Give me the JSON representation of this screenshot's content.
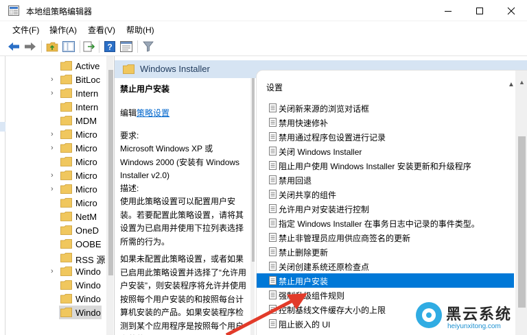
{
  "window": {
    "title": "本地组策略编辑器"
  },
  "menu": [
    "文件(F)",
    "操作(A)",
    "查看(V)",
    "帮助(H)"
  ],
  "tree": {
    "items": [
      {
        "label": "Active",
        "expandable": false
      },
      {
        "label": "BitLoc",
        "expandable": true
      },
      {
        "label": "Intern",
        "expandable": true
      },
      {
        "label": "Intern",
        "expandable": false
      },
      {
        "label": "MDM",
        "expandable": false
      },
      {
        "label": "Micro",
        "expandable": true
      },
      {
        "label": "Micro",
        "expandable": true
      },
      {
        "label": "Micro",
        "expandable": false
      },
      {
        "label": "Micro",
        "expandable": true
      },
      {
        "label": "Micro",
        "expandable": true
      },
      {
        "label": "Micro",
        "expandable": false
      },
      {
        "label": "NetM",
        "expandable": false
      },
      {
        "label": "OneD",
        "expandable": false
      },
      {
        "label": "OOBE",
        "expandable": false
      },
      {
        "label": "RSS 源",
        "expandable": false
      },
      {
        "label": "Windo",
        "expandable": true
      },
      {
        "label": "Windo",
        "expandable": false
      },
      {
        "label": "Windo",
        "expandable": false
      },
      {
        "label": "Windo",
        "expandable": false,
        "selected": true
      }
    ]
  },
  "panel": {
    "header": "Windows Installer",
    "description": {
      "title": "禁止用户安装",
      "edit_prefix": "编辑",
      "edit_link": "策略设置",
      "requirements_label": "要求:",
      "requirements": "Microsoft Windows XP 或 Windows 2000 (安装有 Windows Installer v2.0)",
      "desc_label": "描述:",
      "desc_text": "使用此策略设置可以配置用户安装。若要配置此策略设置，请将其设置为已启用并使用下拉列表选择所需的行为。",
      "desc_text2": "如果未配置此策略设置，或者如果已启用此策略设置并选择了“允许用户安装”，则安装程序将允许并使用按照每个用户安装的和按照每台计算机安装的产品。如果安装程序检测到某个应用程序是按照每个用户安装的，"
    },
    "list": {
      "column_header": "设置",
      "rows": [
        "关闭新来源的浏览对话框",
        "禁用快速修补",
        "禁用通过程序包设置进行记录",
        "关闭 Windows Installer",
        "阻止用户使用 Windows Installer 安装更新和升级程序",
        "禁用回退",
        "关闭共享的组件",
        "允许用户对安装进行控制",
        "指定 Windows Installer 在事务日志中记录的事件类型。",
        "禁止非管理员应用供应商签名的更新",
        "禁止删除更新",
        "关闭创建系统还原检查点",
        "禁止用户安装",
        "强制升级组件规则",
        "控制基线文件缓存大小的上限",
        "阻止嵌入的 UI"
      ],
      "selected_index": 12
    }
  },
  "watermark": {
    "name": "黑云系统",
    "url": "heiyunxitong.com"
  },
  "colors": {
    "selection": "#0078d7",
    "header_band": "#d6e4f3",
    "link": "#0066cc"
  }
}
